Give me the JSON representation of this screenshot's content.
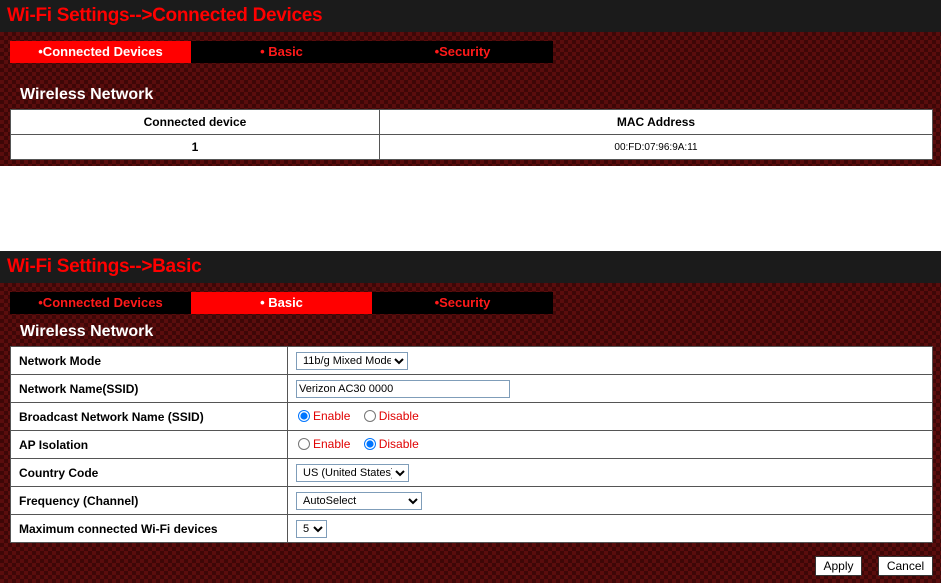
{
  "connected_panel": {
    "title": "Wi-Fi Settings-->Connected Devices",
    "tabs": [
      "•Connected Devices",
      "• Basic",
      "•Security"
    ],
    "active_tab": 0,
    "section": "Wireless Network",
    "columns": [
      "Connected device",
      "MAC Address"
    ],
    "rows": [
      {
        "device": "1",
        "mac": "00:FD:07:96:9A:11"
      }
    ]
  },
  "basic_panel": {
    "title": "Wi-Fi Settings-->Basic",
    "tabs": [
      "•Connected Devices",
      "• Basic",
      "•Security"
    ],
    "active_tab": 1,
    "section": "Wireless Network",
    "fields": {
      "network_mode": {
        "label": "Network Mode",
        "value": "11b/g Mixed Mode"
      },
      "ssid": {
        "label": "Network Name(SSID)",
        "value": "Verizon AC30 0000"
      },
      "broadcast": {
        "label": "Broadcast Network Name (SSID)",
        "options": [
          "Enable",
          "Disable"
        ],
        "selected": "Enable"
      },
      "ap_isolation": {
        "label": "AP Isolation",
        "options": [
          "Enable",
          "Disable"
        ],
        "selected": "Disable"
      },
      "country": {
        "label": "Country Code",
        "value": "US (United States)"
      },
      "frequency": {
        "label": "Frequency (Channel)",
        "value": "AutoSelect"
      },
      "max_devices": {
        "label": "Maximum connected Wi-Fi devices",
        "value": "5"
      }
    },
    "buttons": {
      "apply": "Apply",
      "cancel": "Cancel"
    }
  },
  "colors": {
    "accent": "#ff0000",
    "header_bg": "#1b1b1b",
    "body_bg": "#5a0d0d"
  }
}
